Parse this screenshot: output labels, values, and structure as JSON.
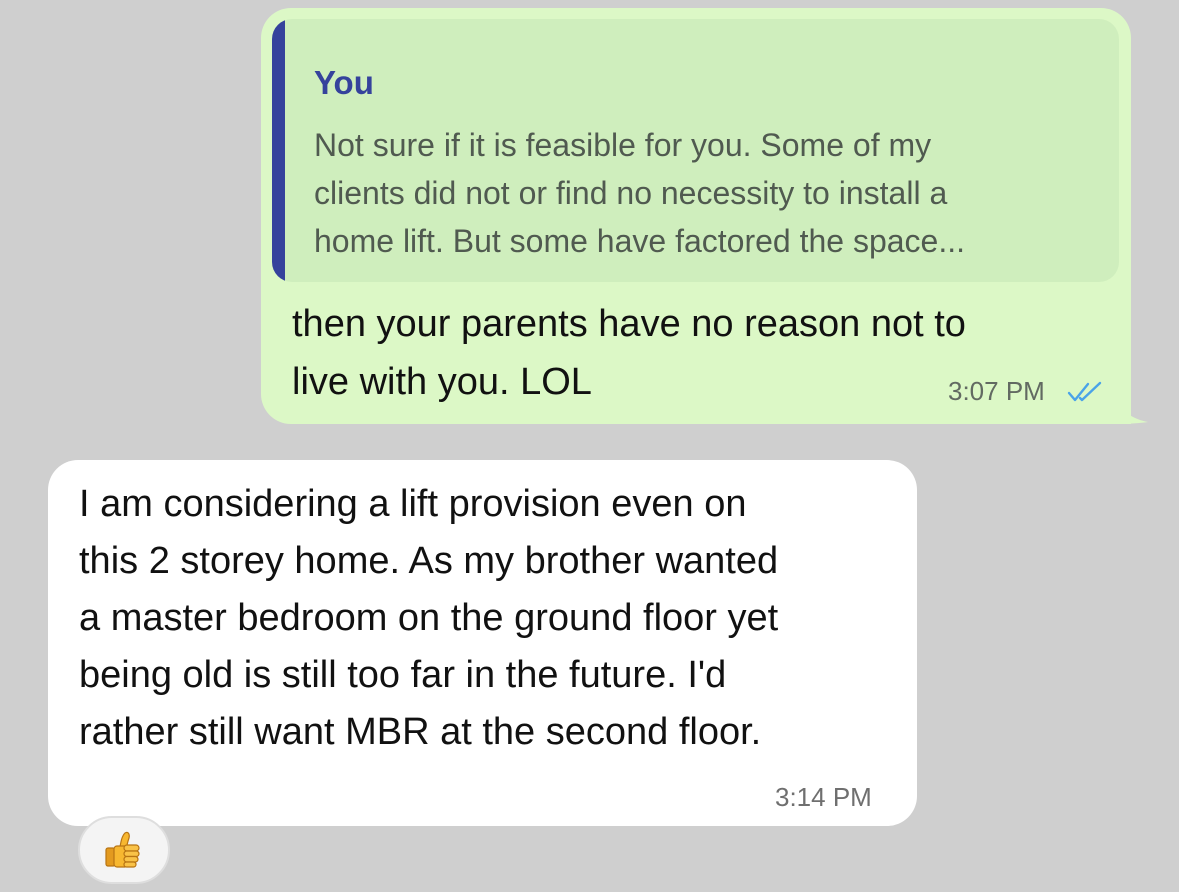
{
  "outgoing": {
    "quote": {
      "author": "You",
      "lines": [
        "Not sure if it is feasible for you. Some of my",
        "clients did not or find no necessity to install a",
        "home lift. But some have factored the space..."
      ],
      "accent_color": "#35429c"
    },
    "lines": [
      "then your parents have no reason not to",
      "live with you. LOL"
    ],
    "time": "3:07 PM",
    "status_icon": "double-check-icon",
    "bubble_color": "#dcf8c6"
  },
  "incoming": {
    "lines": [
      "I am considering a lift provision even on",
      "this 2 storey home. As my brother wanted",
      "a master bedroom on the ground floor yet",
      "being old is still too far in the future. I'd",
      "rather still want MBR at the second floor."
    ],
    "time": "3:14 PM",
    "bubble_color": "#ffffff"
  },
  "reaction": {
    "icon": "thumbs-up-icon"
  }
}
